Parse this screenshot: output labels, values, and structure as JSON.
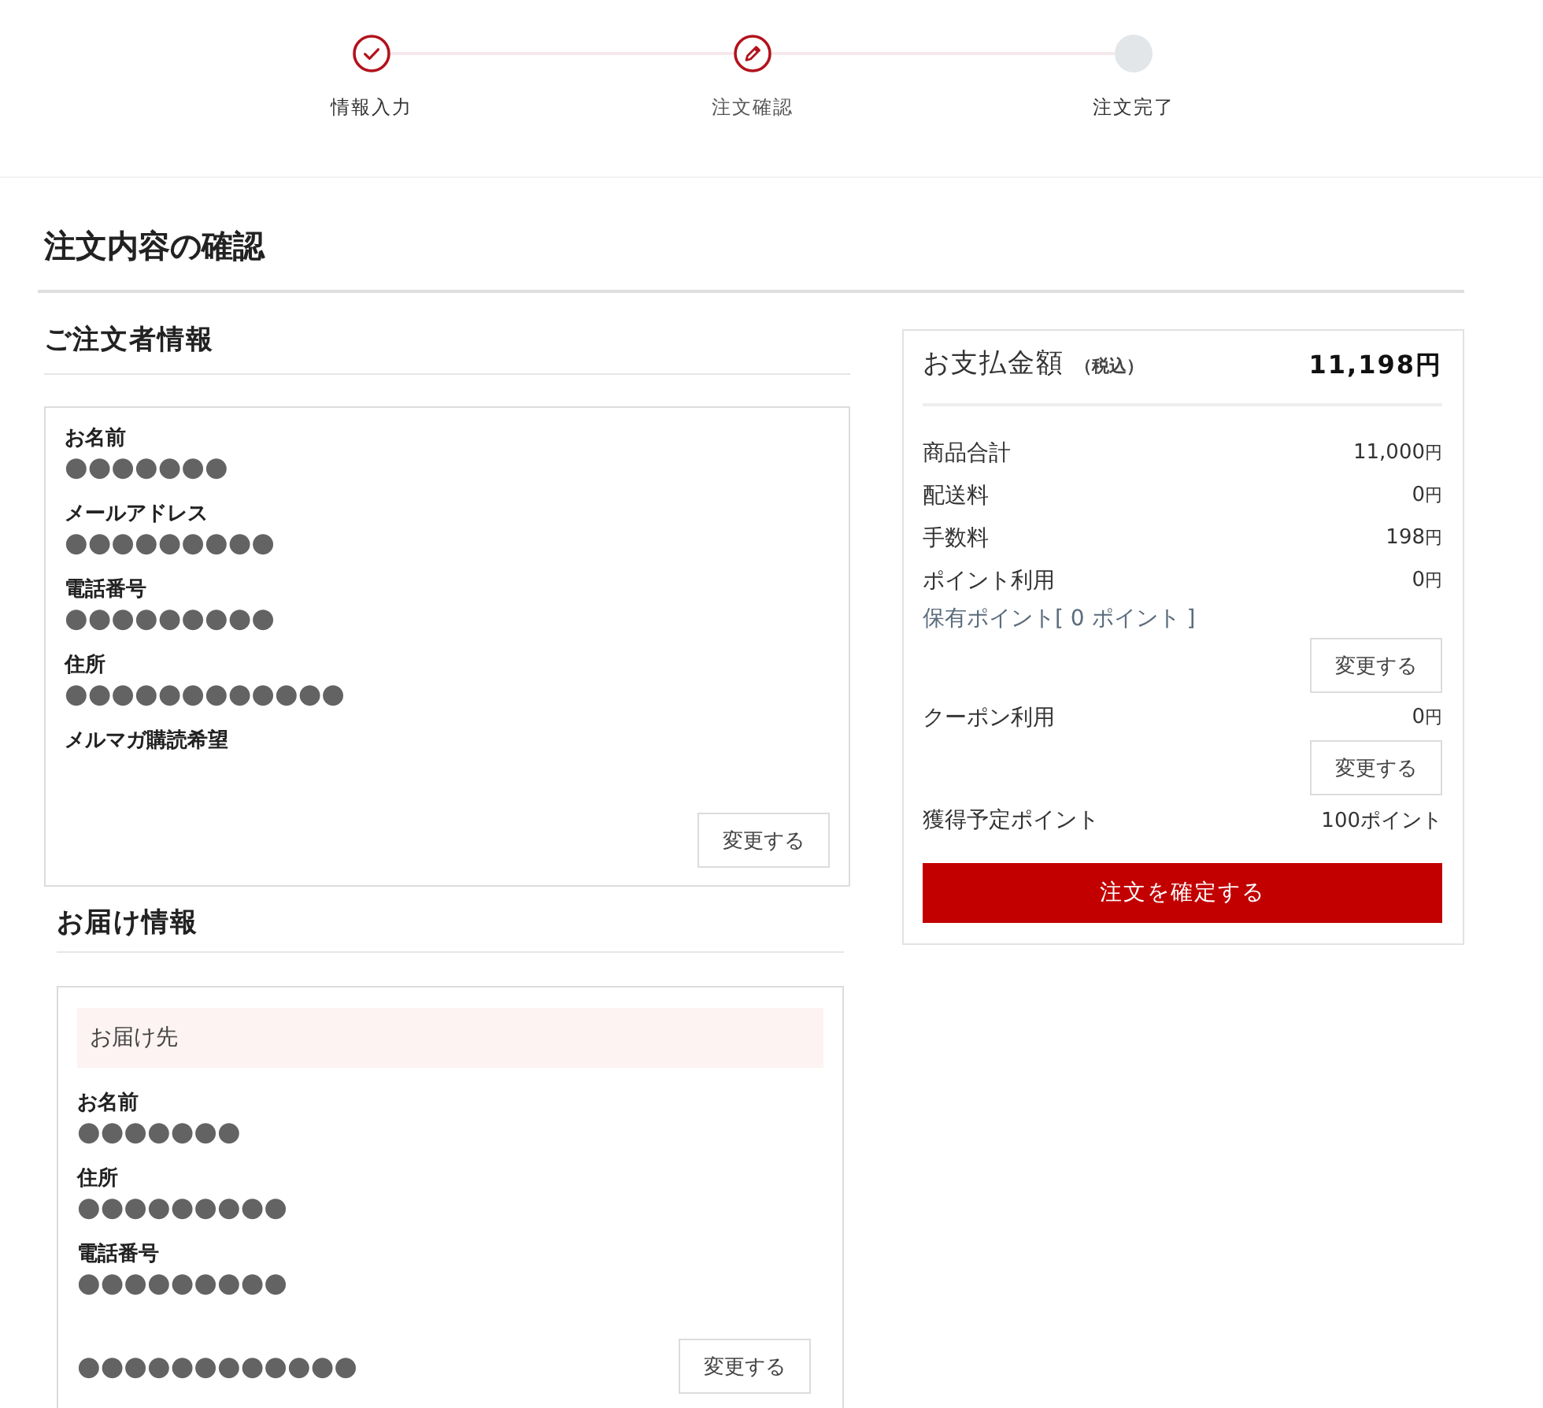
{
  "stepper": {
    "steps": [
      {
        "label": "情報入力",
        "completed": true,
        "current": false
      },
      {
        "label": "注文確認",
        "completed": false,
        "current": true
      },
      {
        "label": "注文完了",
        "completed": false,
        "current": false
      }
    ]
  },
  "page_title": "注文内容の確認",
  "orderer": {
    "heading": "ご注文者情報",
    "fields": [
      {
        "label": "お名前",
        "value": "●●●●●●●"
      },
      {
        "label": "メールアドレス",
        "value": "●●●●●●●●●"
      },
      {
        "label": "電話番号",
        "value": "●●●●●●●●●"
      },
      {
        "label": "住所",
        "value": "●●●●●●●●●●●●"
      },
      {
        "label": "メルマガ購読希望"
      }
    ],
    "change_button": "変更する"
  },
  "delivery": {
    "heading": "お届け情報",
    "destination_label": "お届け先",
    "fields": [
      {
        "label": "お名前",
        "value": "●●●●●●●"
      },
      {
        "label": "住所",
        "value": "●●●●●●●●●"
      },
      {
        "label": "電話番号",
        "value": "●●●●●●●●●"
      }
    ],
    "footer_value": "●●●●●●●●●●●●",
    "change_button": "変更する"
  },
  "payment": {
    "title": "お支払金額",
    "tax_note": "（税込）",
    "total": "11,198円",
    "rows": [
      {
        "kind": "amount",
        "label": "商品合計",
        "value": "11,000",
        "unit": "円"
      },
      {
        "kind": "amount",
        "label": "配送料",
        "value": "0",
        "unit": "円"
      },
      {
        "kind": "amount",
        "label": "手数料",
        "value": "198",
        "unit": "円"
      },
      {
        "kind": "amount",
        "label": "ポイント利用",
        "value": "0",
        "unit": "円"
      },
      {
        "kind": "note",
        "text": "保有ポイント[ 0 ポイント ]"
      },
      {
        "kind": "button",
        "label": "変更する"
      },
      {
        "kind": "amount",
        "label": "クーポン利用",
        "value": "0",
        "unit": "円"
      },
      {
        "kind": "button",
        "label": "変更する"
      },
      {
        "kind": "amount",
        "label": "獲得予定ポイント",
        "value": "100ポイント"
      }
    ],
    "confirm_button": "注文を確定する"
  }
}
